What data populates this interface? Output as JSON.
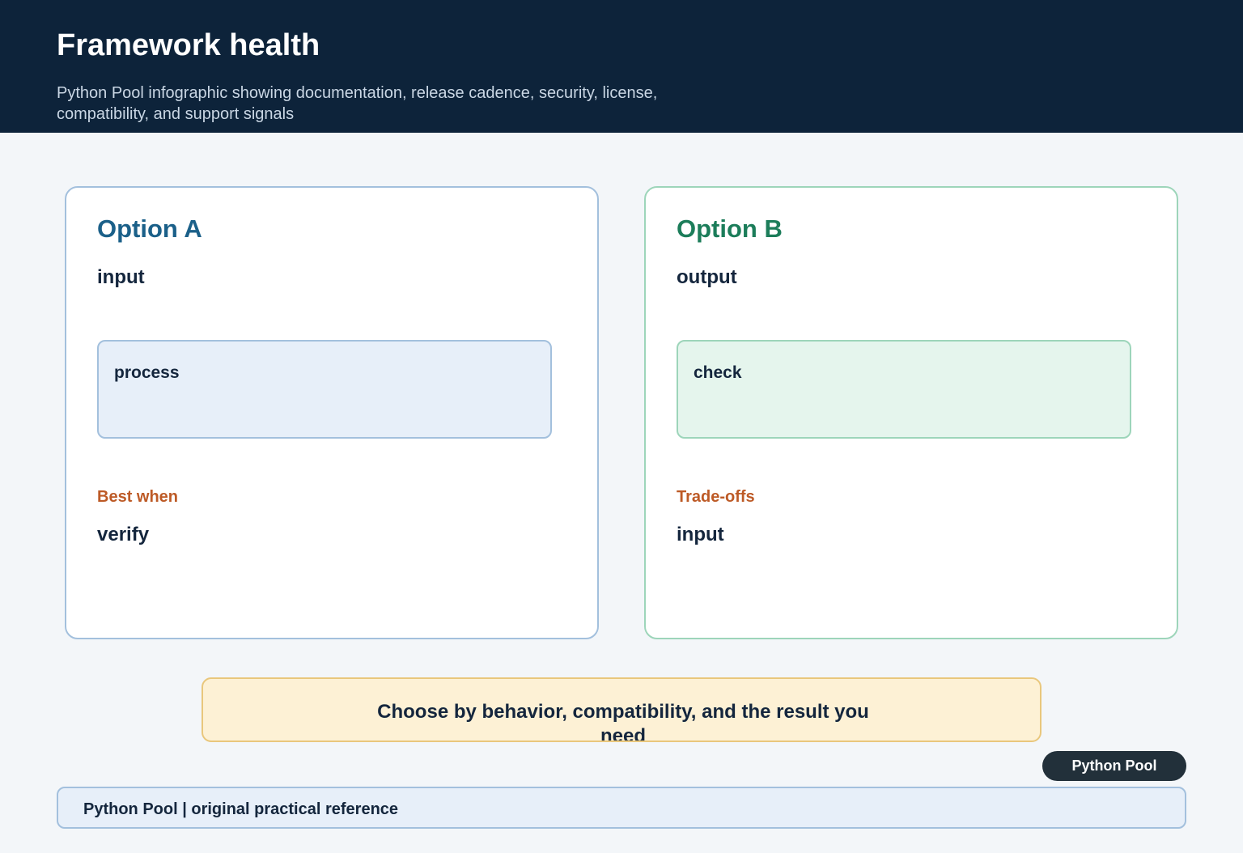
{
  "header": {
    "title": "Framework health",
    "subtitle": "Python Pool infographic showing documentation, release cadence, security, license, compatibility, and support signals"
  },
  "option_a": {
    "title": "Option A",
    "item": "input",
    "box_label": "process",
    "section_label": "Best when",
    "section_value": "verify"
  },
  "option_b": {
    "title": "Option B",
    "item": "output",
    "box_label": "check",
    "section_label": "Trade-offs",
    "section_value": "input"
  },
  "callout": {
    "text": "Choose by behavior, compatibility, and the result you need"
  },
  "badge": {
    "label": "Python Pool"
  },
  "footer": {
    "text": "Python Pool | original practical reference"
  },
  "colors": {
    "header_bg": "#0d233a",
    "option_a_accent": "#1b6089",
    "option_b_accent": "#1c7d5a",
    "section_label": "#bd5a26",
    "callout_bg": "#fdf1d5",
    "callout_border": "#e9c77c",
    "badge_bg": "#22303a"
  }
}
